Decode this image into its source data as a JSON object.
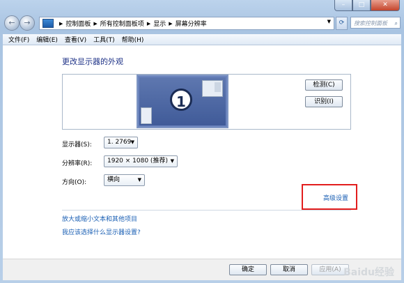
{
  "window": {
    "controls": {
      "minimize": "–",
      "maximize": "□",
      "close": "✕"
    }
  },
  "navigation": {
    "back_icon": "←",
    "forward_icon": "→",
    "breadcrumb": [
      "控制面板",
      "所有控制面板项",
      "显示",
      "屏幕分辨率"
    ],
    "dropdown_icon": "▼",
    "refresh_icon": "⟳",
    "search_placeholder": "搜索控制面板",
    "search_icon": "⌕"
  },
  "menubar": {
    "items": [
      "文件(F)",
      "编辑(E)",
      "查看(V)",
      "工具(T)",
      "帮助(H)"
    ]
  },
  "page": {
    "heading": "更改显示器的外观",
    "monitor_number": "1",
    "detect_button": "检测(C)",
    "identify_button": "识别(I)"
  },
  "settings": {
    "display_label": "显示器(S):",
    "display_value": "1. 2769",
    "resolution_label": "分辨率(R):",
    "resolution_value": "1920 × 1080 (推荐)",
    "orientation_label": "方向(O):",
    "orientation_value": "横向",
    "advanced_link": "高级设置"
  },
  "links": {
    "text_size": "放大或缩小文本和其他项目",
    "which_settings": "我应该选择什么显示器设置?"
  },
  "buttons": {
    "ok": "确定",
    "cancel": "取消",
    "apply": "应用(A)"
  },
  "watermark": "Baidu经验",
  "colors": {
    "highlight_border": "#e21d1d",
    "link": "#1a5fb4",
    "heading": "#1e3287"
  }
}
